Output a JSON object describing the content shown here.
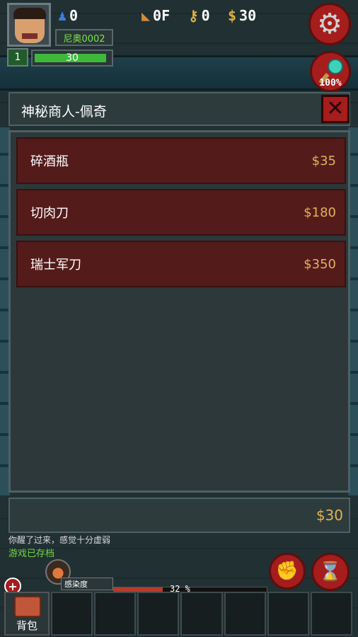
{
  "hud": {
    "allies": "0",
    "floor": "0F",
    "keys": "0",
    "gold": "30",
    "player_name": "尼奥0002",
    "level": "1",
    "hp": "30",
    "hp_fraction": 0.95,
    "search_pct": "100%"
  },
  "shop": {
    "title": "神秘商人-佩奇",
    "items": [
      {
        "name": "碎酒瓶",
        "price": "$35"
      },
      {
        "name": "切肉刀",
        "price": "$180"
      },
      {
        "name": "瑞士军刀",
        "price": "$350"
      }
    ],
    "money": "$30"
  },
  "log": {
    "line1": "你醒了过来，感觉十分虚弱",
    "line2": "游戏已存档"
  },
  "status": {
    "infection_label": "感染度",
    "infection_pct": "32 %",
    "infection_fraction": 0.32
  },
  "inventory": {
    "bag_label": "背包",
    "slots": 7
  },
  "icons": {
    "allies": "allies-icon",
    "floor": "stairs-icon",
    "key": "key-icon",
    "gold": "dollar-icon",
    "settings": "gear-icon",
    "search": "magnifier-icon",
    "close": "close-icon",
    "attack": "fist-icon",
    "wait": "hourglass-icon",
    "infection": "brain-icon",
    "bag": "backpack-icon"
  },
  "colors": {
    "accent_red": "#a51d1d",
    "price_gold": "#e0b258",
    "hp_green": "#3fb83a",
    "save_green": "#6fd642"
  }
}
